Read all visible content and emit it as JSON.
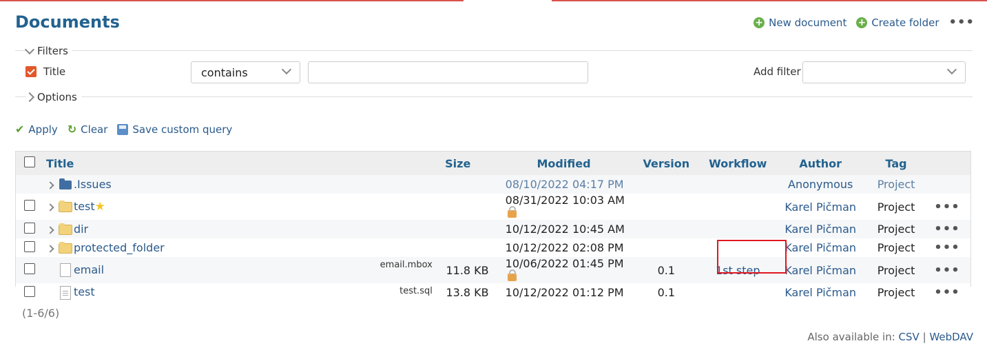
{
  "header": {
    "title": "Documents",
    "new_document": "New document",
    "create_folder": "Create folder",
    "more": "•••"
  },
  "filters": {
    "legend": "Filters",
    "title_label": "Title",
    "operator": "contains",
    "value": "",
    "add_filter_label": "Add filter",
    "add_filter_value": ""
  },
  "options": {
    "legend": "Options"
  },
  "query_actions": {
    "apply": "Apply",
    "clear": "Clear",
    "save": "Save custom query"
  },
  "table": {
    "columns": [
      "Title",
      "Size",
      "Modified",
      "Version",
      "Workflow",
      "Author",
      "Tag"
    ],
    "rows": [
      {
        "type": "folder-blue",
        "title": "Issues",
        "prefix": ".",
        "filename": "",
        "size": "",
        "modified": "08/10/2022 04:17 PM",
        "locked": false,
        "version": "",
        "workflow": "",
        "author": "Anonymous",
        "tag": "Project",
        "star": false,
        "checkbox": false,
        "dim": true
      },
      {
        "type": "folder",
        "title": "test",
        "prefix": "",
        "filename": "",
        "size": "",
        "modified": "08/31/2022 10:03 AM",
        "locked": true,
        "version": "",
        "workflow": "",
        "author": "Karel Pičman",
        "tag": "Project",
        "star": true,
        "checkbox": true,
        "dim": false
      },
      {
        "type": "folder",
        "title": "dir",
        "prefix": "",
        "filename": "",
        "size": "",
        "modified": "10/12/2022 10:45 AM",
        "locked": false,
        "version": "",
        "workflow": "",
        "author": "Karel Pičman",
        "tag": "Project",
        "star": false,
        "checkbox": true,
        "dim": false
      },
      {
        "type": "folder",
        "title": "protected_folder",
        "prefix": "",
        "filename": "",
        "size": "",
        "modified": "10/12/2022 02:08 PM",
        "locked": false,
        "version": "",
        "workflow": "",
        "author": "Karel Pičman",
        "tag": "Project",
        "star": false,
        "checkbox": true,
        "dim": false
      },
      {
        "type": "file",
        "title": "email",
        "prefix": "",
        "filename": "email.mbox",
        "size": "11.8 KB",
        "modified": "10/06/2022 01:45 PM",
        "locked": true,
        "version": "0.1",
        "workflow": "1st step",
        "author": "Karel Pičman",
        "tag": "Project",
        "star": false,
        "checkbox": true,
        "dim": false
      },
      {
        "type": "file-text",
        "title": "test",
        "prefix": "",
        "filename": "test.sql",
        "size": "13.8 KB",
        "modified": "10/12/2022 01:12 PM",
        "locked": false,
        "version": "0.1",
        "workflow": "",
        "author": "Karel Pičman",
        "tag": "Project",
        "star": false,
        "checkbox": true,
        "dim": false
      }
    ]
  },
  "pagination": "(1-6/6)",
  "footer": {
    "also_available": "Also available in:",
    "csv": "CSV",
    "separator": "|",
    "webdav": "WebDAV"
  },
  "colors": {
    "accent": "#22628f",
    "link": "#2a5a8c",
    "highlight": "#e0171f"
  }
}
